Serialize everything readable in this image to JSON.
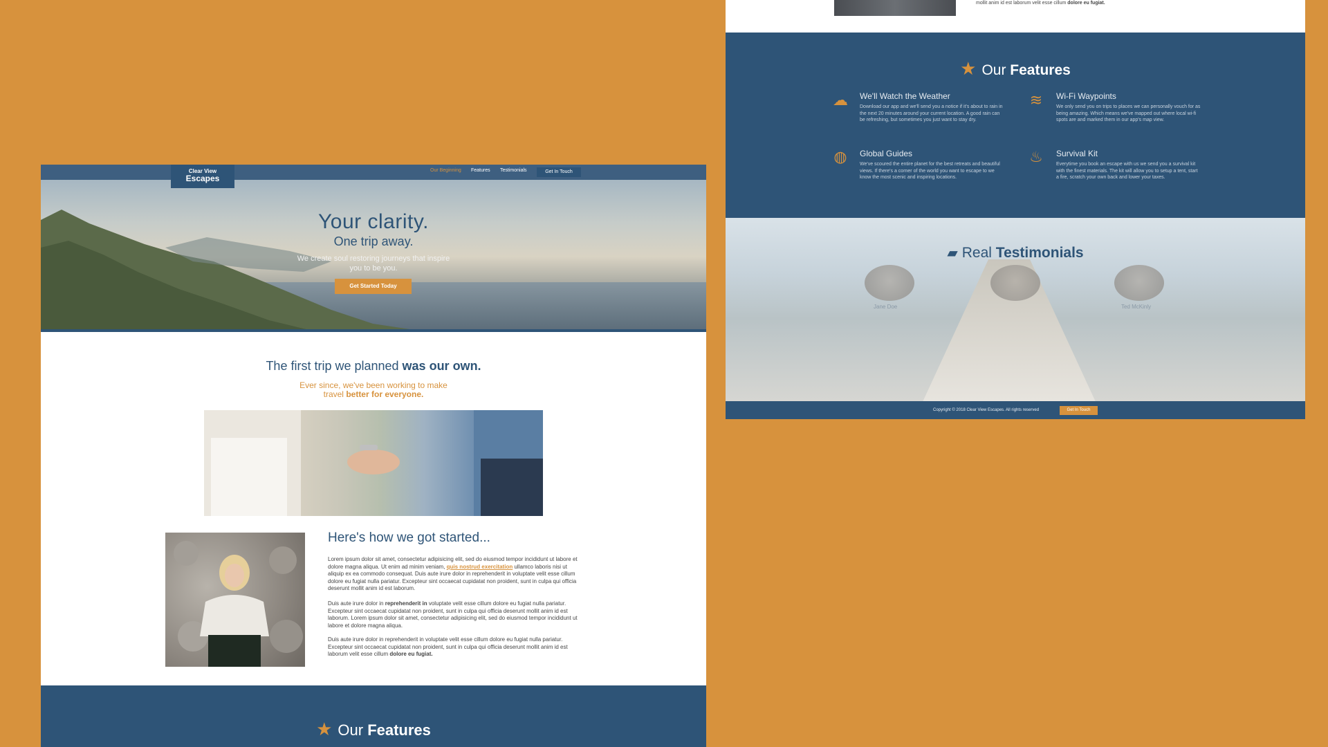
{
  "brand": {
    "line1": "Clear View",
    "line2": "Escapes"
  },
  "nav": {
    "items": [
      "Our Beginning",
      "Features",
      "Testimonials"
    ],
    "cta": "Get In Touch"
  },
  "hero": {
    "title": "Your clarity.",
    "subtitle": "One trip away.",
    "description": "We create soul restoring journeys that inspire you to be you.",
    "button": "Get Started Today"
  },
  "story": {
    "heading_plain": "The first trip we planned ",
    "heading_bold": "was our own.",
    "sub_plain": "Ever since, we've been working to make travel ",
    "sub_bold": "better for everyone.",
    "title": "Here's how we got started...",
    "p1_a": "Lorem ipsum dolor sit amet, consectetur adipisicing elit, sed do eiusmod tempor incididunt ut labore et dolore magna aliqua. Ut enim ad minim veniam, ",
    "p1_link": "quis nostrud exercitation",
    "p1_b": " ullamco laboris nisi ut aliquip ex ea commodo consequat. Duis aute irure dolor in reprehenderit in voluptate velit esse cillum dolore eu fugiat nulla pariatur. Excepteur sint occaecat cupidatat non proident, sunt in culpa qui officia deserunt mollit anim id est laborum.",
    "p2_a": "Duis aute irure dolor in ",
    "p2_bold": "reprehenderit in",
    "p2_b": " voluptate velit esse cillum dolore eu fugiat nulla pariatur. Excepteur sint occaecat cupidatat non proident, sunt in culpa qui officia deserunt mollit anim id est laborum. Lorem ipsum dolor sit amet, consectetur adipisicing elit, sed do eiusmod tempor incididunt ut labore et dolore magna aliqua.",
    "p3_a": "Duis aute irure dolor in reprehenderit in voluptate velit esse cillum dolore eu fugiat nulla pariatur. Excepteur sint occaecat cupidatat non proident, sunt in culpa qui officia deserunt mollit anim id est laborum velit esse cillum ",
    "p3_bold": "dolore eu fugiat."
  },
  "features": {
    "title_plain": "Our ",
    "title_bold": "Features",
    "items": [
      {
        "icon": "cloud-rain-icon",
        "title": "We'll Watch the Weather",
        "text": "Download our app and we'll send you a notice if it's about to rain in the next 20 minutes around your current location. A good rain can be refreshing, but sometimes you just want to stay dry."
      },
      {
        "icon": "wifi-icon",
        "title": "Wi-Fi Waypoints",
        "text": "We only send you on trips to places we can personally vouch for as being amazing. Which means we've mapped out where local wi-fi spots are and marked them in our app's map view."
      },
      {
        "icon": "globe-icon",
        "title": "Global Guides",
        "text": "We've scoured the entire planet for the best retreats and beautiful views. If there's a corner of the world you want to escape to we know the most scenic and inspiring locations."
      },
      {
        "icon": "fire-icon",
        "title": "Survival Kit",
        "text": "Everytime you book an escape with us we send you a survival kit with the finest materials. The kit will allow you to setup a tent, start a fire, scratch your own back and lower your taxes."
      }
    ]
  },
  "top_snippet": {
    "text_a": "mollit anim id est laborum velit esse cillum ",
    "text_bold": "dolore eu fugiat."
  },
  "testimonials": {
    "title_plain": "Real ",
    "title_bold": "Testimonials",
    "names": [
      "Jane Doe",
      "",
      "Ted McKinly"
    ]
  },
  "footer": {
    "copyright": "Copyright © 2018 Clear View Escapes. All rights reserved",
    "cta": "Get In Touch"
  },
  "colors": {
    "brand_blue": "#2e5477",
    "accent_orange": "#d7923d",
    "background": "#d7923d"
  }
}
